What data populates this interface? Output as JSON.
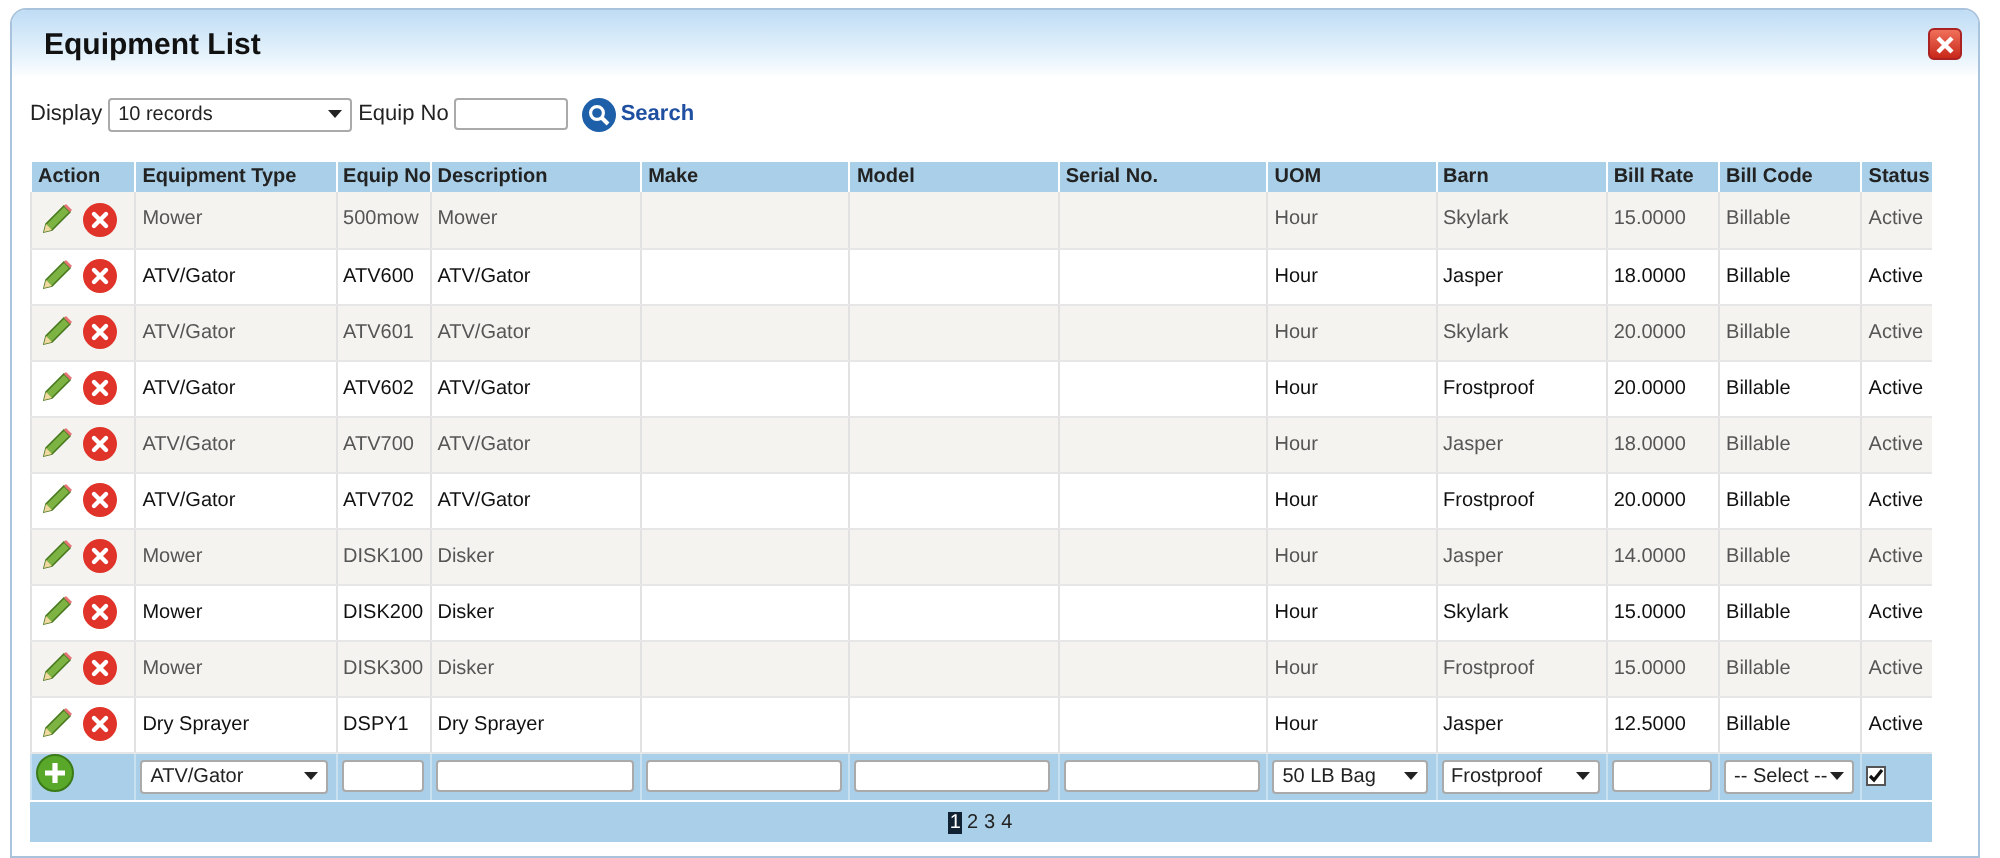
{
  "window": {
    "title": "Equipment List"
  },
  "filters": {
    "display_label": "Display",
    "display_value": "10 records",
    "equip_no_label": "Equip No",
    "search_label": "Search"
  },
  "table": {
    "columns": [
      "Action",
      "Equipment Type",
      "Equip No",
      "Description",
      "Make",
      "Model",
      "Serial No.",
      "UOM",
      "Barn",
      "Bill Rate",
      "Bill Code",
      "Status"
    ],
    "rows": [
      [
        "",
        "Mower",
        "500mow",
        "Mower",
        "",
        "",
        "",
        "Hour",
        "Skylark",
        "15.0000",
        "Billable",
        "Active"
      ],
      [
        "",
        "ATV/Gator",
        "ATV600",
        "ATV/Gator",
        "",
        "",
        "",
        "Hour",
        "Jasper",
        "18.0000",
        "Billable",
        "Active"
      ],
      [
        "",
        "ATV/Gator",
        "ATV601",
        "ATV/Gator",
        "",
        "",
        "",
        "Hour",
        "Skylark",
        "20.0000",
        "Billable",
        "Active"
      ],
      [
        "",
        "ATV/Gator",
        "ATV602",
        "ATV/Gator",
        "",
        "",
        "",
        "Hour",
        "Frostproof",
        "20.0000",
        "Billable",
        "Active"
      ],
      [
        "",
        "ATV/Gator",
        "ATV700",
        "ATV/Gator",
        "",
        "",
        "",
        "Hour",
        "Jasper",
        "18.0000",
        "Billable",
        "Active"
      ],
      [
        "",
        "ATV/Gator",
        "ATV702",
        "ATV/Gator",
        "",
        "",
        "",
        "Hour",
        "Frostproof",
        "20.0000",
        "Billable",
        "Active"
      ],
      [
        "",
        "Mower",
        "DISK100",
        "Disker",
        "",
        "",
        "",
        "Hour",
        "Jasper",
        "14.0000",
        "Billable",
        "Active"
      ],
      [
        "",
        "Mower",
        "DISK200",
        "Disker",
        "",
        "",
        "",
        "Hour",
        "Skylark",
        "15.0000",
        "Billable",
        "Active"
      ],
      [
        "",
        "Mower",
        "DISK300",
        "Disker",
        "",
        "",
        "",
        "Hour",
        "Frostproof",
        "15.0000",
        "Billable",
        "Active"
      ],
      [
        "",
        "Dry Sprayer",
        "DSPY1",
        "Dry Sprayer",
        "",
        "",
        "",
        "Hour",
        "Jasper",
        "12.5000",
        "Billable",
        "Active"
      ]
    ],
    "add_row": [
      {
        "kind": "select",
        "value": "ATV/Gator"
      },
      {
        "kind": "input"
      },
      {
        "kind": "input"
      },
      {
        "kind": "input"
      },
      {
        "kind": "input"
      },
      {
        "kind": "input"
      },
      {
        "kind": "select",
        "value": "50 LB  Bag"
      },
      {
        "kind": "select",
        "value": "Frostproof"
      },
      {
        "kind": "input"
      },
      {
        "kind": "select",
        "value": "-- Select --"
      },
      {
        "kind": "checkbox",
        "checked": true
      }
    ]
  },
  "pager": [
    {
      "label": "1",
      "selected": true
    },
    {
      "label": "2",
      "selected": false
    },
    {
      "label": "3",
      "selected": false
    },
    {
      "label": "4",
      "selected": false
    }
  ]
}
